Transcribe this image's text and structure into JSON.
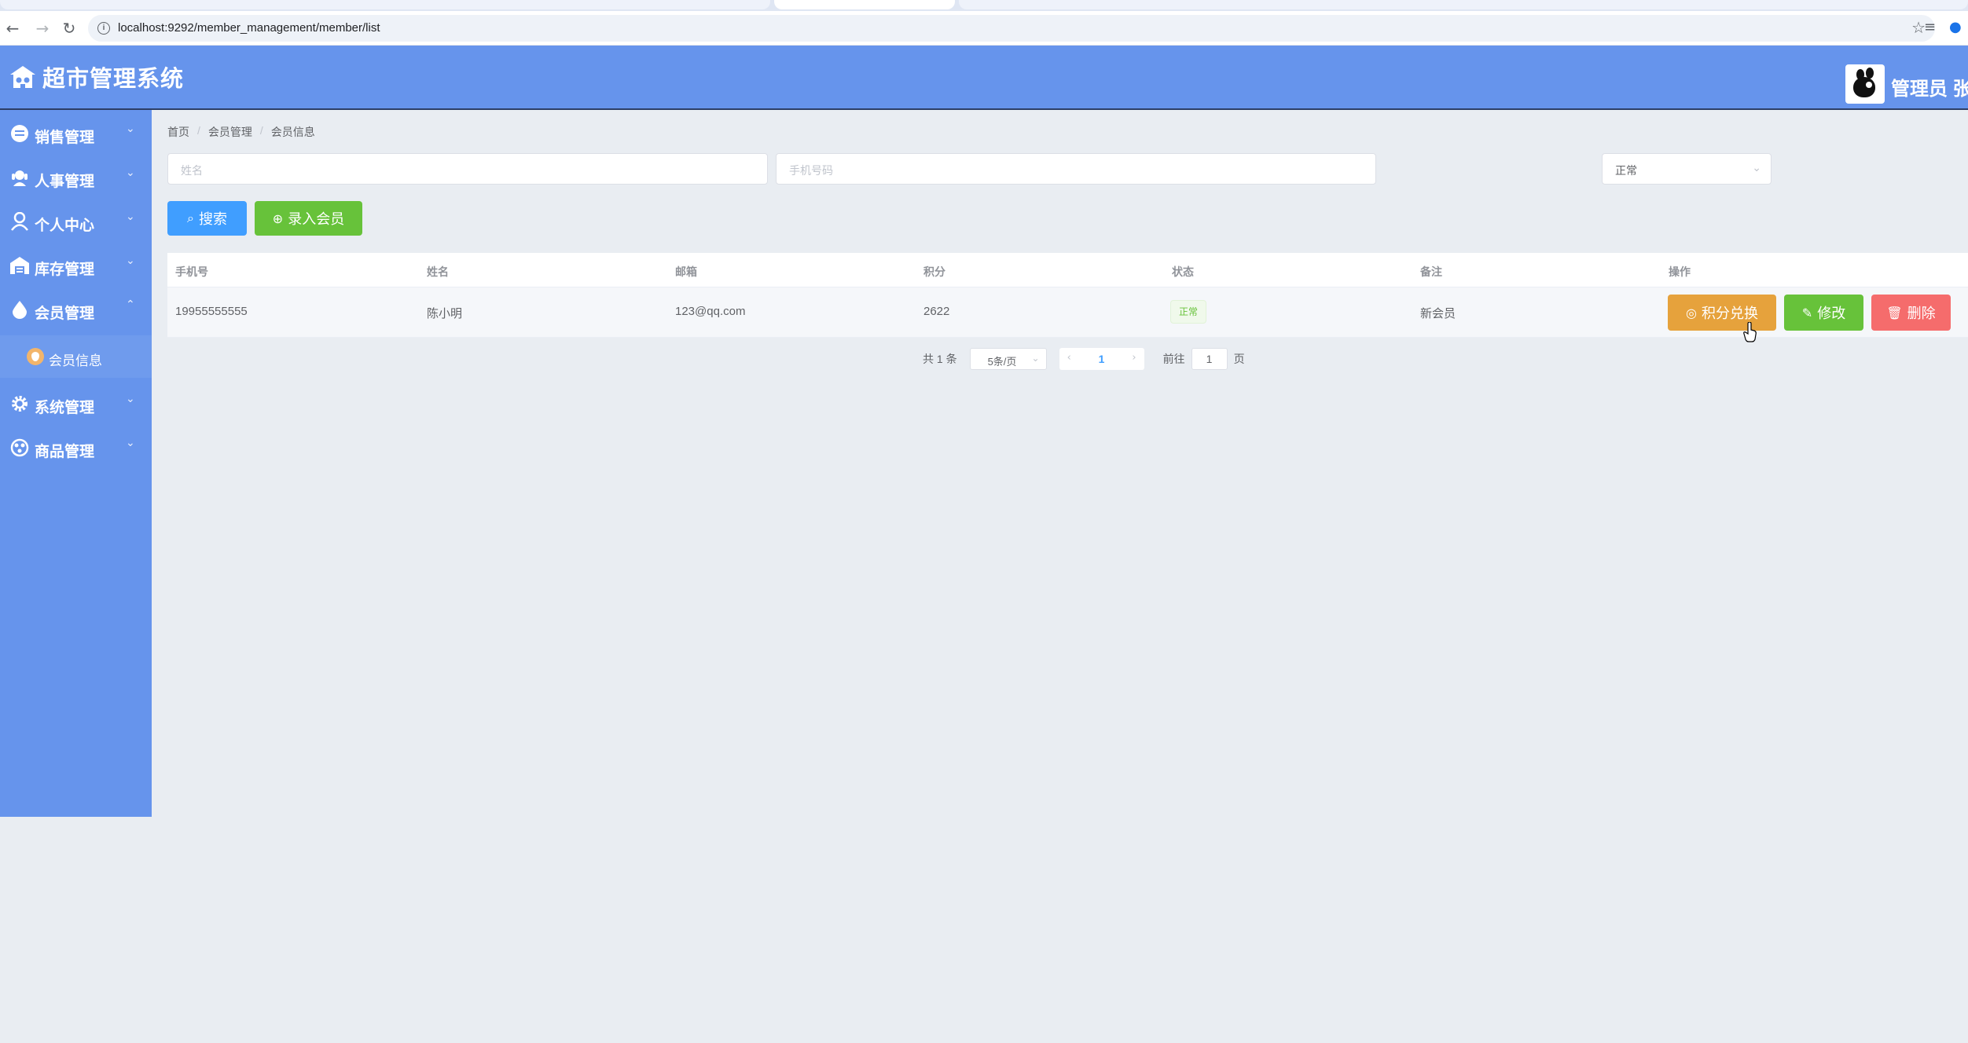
{
  "browser": {
    "url": "localhost:9292/member_management/member/list"
  },
  "header": {
    "app_title": "超市管理系统",
    "user_label": "管理员 张"
  },
  "sidebar": {
    "items": [
      {
        "label": "销售管理",
        "icon": "sales-icon",
        "expanded": false
      },
      {
        "label": "人事管理",
        "icon": "personnel-icon",
        "expanded": false
      },
      {
        "label": "个人中心",
        "icon": "user-icon",
        "expanded": false
      },
      {
        "label": "库存管理",
        "icon": "warehouse-icon",
        "expanded": false
      },
      {
        "label": "会员管理",
        "icon": "member-drop-icon",
        "expanded": true
      },
      {
        "label": "系统管理",
        "icon": "gear-icon",
        "expanded": false
      },
      {
        "label": "商品管理",
        "icon": "goods-icon",
        "expanded": false
      }
    ],
    "sub_items": [
      {
        "label": "会员信息",
        "icon": "member-info-icon"
      }
    ]
  },
  "breadcrumb": [
    "首页",
    "会员管理",
    "会员信息"
  ],
  "filters": {
    "name_placeholder": "姓名",
    "phone_placeholder": "手机号码",
    "status_value": "正常"
  },
  "actions": {
    "search_label": "搜索",
    "add_member_label": "录入会员"
  },
  "table": {
    "columns": [
      "手机号",
      "姓名",
      "邮箱",
      "积分",
      "状态",
      "备注",
      "操作"
    ],
    "rows": [
      {
        "phone": "19955555555",
        "name": "陈小明",
        "email": "123@qq.com",
        "points": "2622",
        "status": "正常",
        "note": "新会员"
      }
    ],
    "row_actions": {
      "redeem_label": "积分兑换",
      "edit_label": "修改",
      "delete_label": "删除"
    }
  },
  "pagination": {
    "total_text": "共 1 条",
    "page_size": "5条/页",
    "current_page": "1",
    "goto_prefix": "前往",
    "goto_value": "1",
    "goto_suffix": "页"
  },
  "colors": {
    "sidebar": "#6694ec",
    "primary": "#409eff",
    "success": "#67c23a",
    "warning": "#e6a23c",
    "danger": "#f56c6c"
  }
}
